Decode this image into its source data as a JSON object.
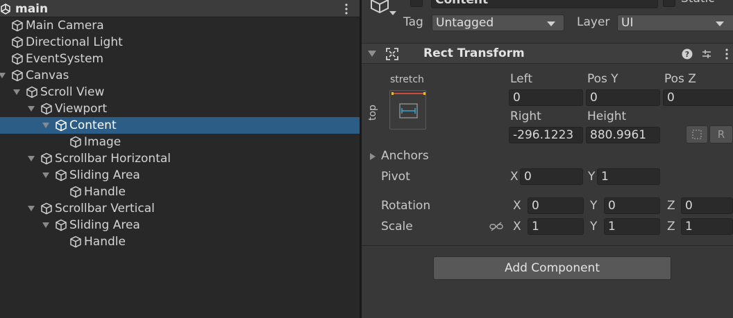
{
  "hierarchy": {
    "scene_name": "main",
    "items": [
      {
        "label": "Main Camera",
        "indent": 0,
        "arrow": false,
        "selected": false,
        "icon": "cube-icon"
      },
      {
        "label": "Directional Light",
        "indent": 0,
        "arrow": false,
        "selected": false,
        "icon": "cube-icon"
      },
      {
        "label": "EventSystem",
        "indent": 0,
        "arrow": false,
        "selected": false,
        "icon": "cube-icon"
      },
      {
        "label": "Canvas",
        "indent": 0,
        "arrow": true,
        "selected": false,
        "icon": "cube-icon"
      },
      {
        "label": "Scroll View",
        "indent": 1,
        "arrow": true,
        "selected": false,
        "icon": "cube-icon"
      },
      {
        "label": "Viewport",
        "indent": 2,
        "arrow": true,
        "selected": false,
        "icon": "cube-icon"
      },
      {
        "label": "Content",
        "indent": 3,
        "arrow": true,
        "selected": true,
        "icon": "cube-icon"
      },
      {
        "label": "Image",
        "indent": 4,
        "arrow": false,
        "selected": false,
        "icon": "cube-icon"
      },
      {
        "label": "Scrollbar Horizontal",
        "indent": 2,
        "arrow": true,
        "selected": false,
        "icon": "cube-icon"
      },
      {
        "label": "Sliding Area",
        "indent": 3,
        "arrow": true,
        "selected": false,
        "icon": "cube-icon"
      },
      {
        "label": "Handle",
        "indent": 4,
        "arrow": false,
        "selected": false,
        "icon": "cube-icon"
      },
      {
        "label": "Scrollbar Vertical",
        "indent": 2,
        "arrow": true,
        "selected": false,
        "icon": "cube-icon"
      },
      {
        "label": "Sliding Area",
        "indent": 3,
        "arrow": true,
        "selected": false,
        "icon": "cube-icon"
      },
      {
        "label": "Handle",
        "indent": 4,
        "arrow": false,
        "selected": false,
        "icon": "cube-icon"
      }
    ]
  },
  "inspector": {
    "object_name": "Content",
    "static_label": "Static",
    "tag_label": "Tag",
    "tag_value": "Untagged",
    "layer_label": "Layer",
    "layer_value": "UI",
    "rect_transform": {
      "title": "Rect Transform",
      "anchor_preset_h": "stretch",
      "anchor_preset_v": "top",
      "left_label": "Left",
      "left_value": "0",
      "posy_label": "Pos Y",
      "posy_value": "0",
      "posz_label": "Pos Z",
      "posz_value": "0",
      "right_label": "Right",
      "right_value": "-296.1223",
      "height_label": "Height",
      "height_value": "880.9961",
      "raw_edit_label": "R",
      "anchors_label": "Anchors",
      "pivot_label": "Pivot",
      "pivot_x_label": "X",
      "pivot_x": "0",
      "pivot_y_label": "Y",
      "pivot_y": "1",
      "rotation_label": "Rotation",
      "rot_x_label": "X",
      "rot_x": "0",
      "rot_y_label": "Y",
      "rot_y": "0",
      "rot_z_label": "Z",
      "rot_z": "0",
      "scale_label": "Scale",
      "scale_x_label": "X",
      "scale_x": "1",
      "scale_y_label": "Y",
      "scale_y": "1",
      "scale_z_label": "Z",
      "scale_z": "1"
    },
    "add_component_label": "Add Component"
  },
  "colors": {
    "selection": "#2c5d87",
    "anchor_red": "#d04a3a",
    "anchor_yellow": "#e6b93c",
    "anchor_blue": "#3aa6d8"
  }
}
